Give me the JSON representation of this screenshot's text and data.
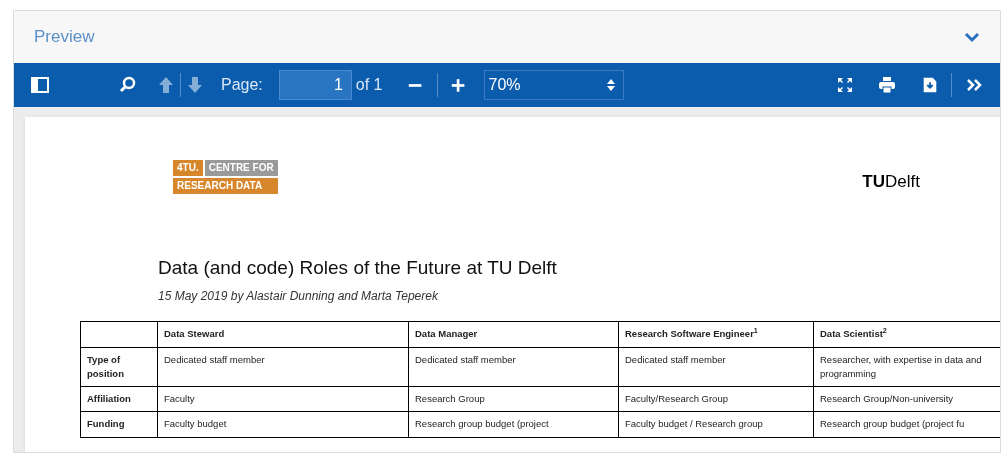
{
  "panel": {
    "title": "Preview",
    "expanded": true
  },
  "toolbar": {
    "page_label": "Page:",
    "page_value": "1",
    "page_total": "of 1",
    "zoom": "70%",
    "prev_disabled": true,
    "next_disabled": true
  },
  "document": {
    "logo_left": {
      "part_1": "4TU.",
      "part_2": "CENTRE FOR",
      "part_3": "RESEARCH DATA"
    },
    "logo_right": {
      "mark": "TU",
      "name": "Delft"
    },
    "title": "Data (and code) Roles of the Future at TU Delft",
    "byline": "15 May 2019 by Alastair Dunning and Marta Teperek",
    "table": {
      "columns": [
        "",
        "Data Steward",
        "Data Manager",
        "Research Software Engineer$^{1}$",
        "Data Scientist$^{2}$"
      ],
      "rows": [
        {
          "cells": [
            "Type of position",
            "Dedicated staff member",
            "Dedicated staff member",
            "Dedicated staff member",
            "Researcher, with expertise in data and programming"
          ]
        },
        {
          "cells": [
            "Affiliation",
            "Faculty",
            "Research Group",
            "Faculty/Research Group",
            "Research Group/Non-university"
          ]
        },
        {
          "cells": [
            "Funding",
            "Faculty budget",
            "Research group budget (project",
            "Faculty budget / Research group",
            "Research group budget (project fu"
          ]
        }
      ]
    }
  }
}
